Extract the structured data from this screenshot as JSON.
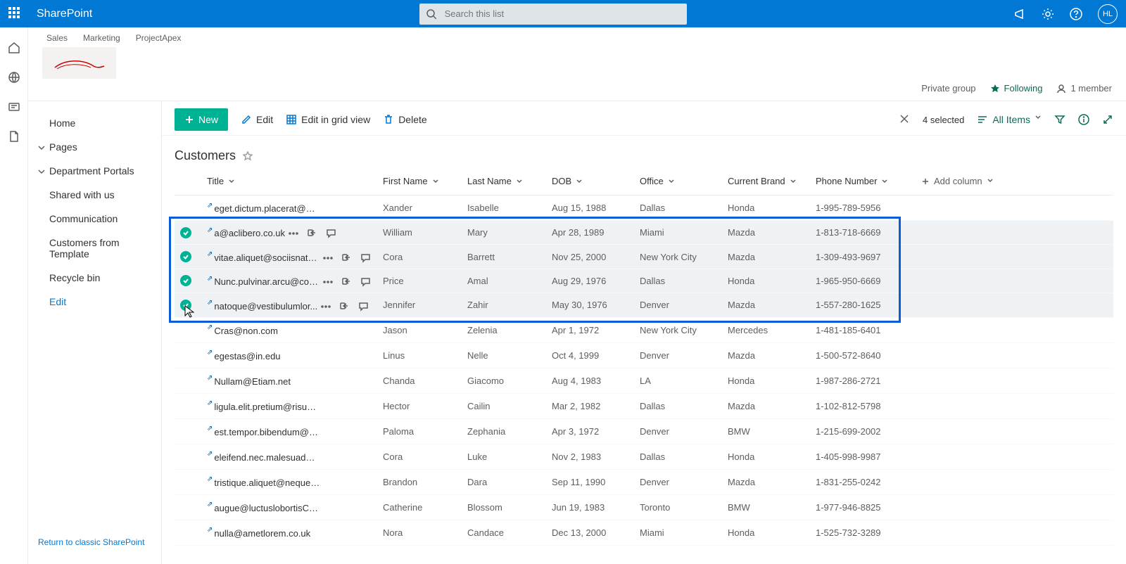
{
  "header": {
    "brand": "SharePoint",
    "search_placeholder": "Search this list",
    "avatar": "HL"
  },
  "site": {
    "tabs": [
      "Sales",
      "Marketing",
      "ProjectApex"
    ],
    "privacy": "Private group",
    "following": "Following",
    "members": "1 member"
  },
  "nav": {
    "items": [
      {
        "label": "Home",
        "chev": false
      },
      {
        "label": "Pages",
        "chev": true
      },
      {
        "label": "Department Portals",
        "chev": true
      },
      {
        "label": "Shared with us",
        "chev": false
      },
      {
        "label": "Communication",
        "chev": false
      },
      {
        "label": "Customers from Template",
        "chev": false
      },
      {
        "label": "Recycle bin",
        "chev": false
      },
      {
        "label": "Edit",
        "chev": false,
        "sel": true
      }
    ],
    "foot": "Return to classic SharePoint"
  },
  "cmd": {
    "new": "New",
    "edit": "Edit",
    "grid": "Edit in grid view",
    "del": "Delete",
    "selected": "4 selected",
    "allitems": "All Items"
  },
  "list": {
    "title": "Customers",
    "columns": [
      "Title",
      "First Name",
      "Last Name",
      "DOB",
      "Office",
      "Current Brand",
      "Phone Number"
    ],
    "addcol": "Add column",
    "rows": [
      {
        "sel": false,
        "title": "eget.dictum.placerat@mattis.ca",
        "first": "Xander",
        "last": "Isabelle",
        "dob": "Aug 15, 1988",
        "office": "Dallas",
        "brand": "Honda",
        "phone": "1-995-789-5956"
      },
      {
        "sel": true,
        "title": "a@aclibero.co.uk",
        "first": "William",
        "last": "Mary",
        "dob": "Apr 28, 1989",
        "office": "Miami",
        "brand": "Mazda",
        "phone": "1-813-718-6669"
      },
      {
        "sel": true,
        "title": "vitae.aliquet@sociisnato...",
        "first": "Cora",
        "last": "Barrett",
        "dob": "Nov 25, 2000",
        "office": "New York City",
        "brand": "Mazda",
        "phone": "1-309-493-9697"
      },
      {
        "sel": true,
        "title": "Nunc.pulvinar.arcu@con...",
        "first": "Price",
        "last": "Amal",
        "dob": "Aug 29, 1976",
        "office": "Dallas",
        "brand": "Honda",
        "phone": "1-965-950-6669"
      },
      {
        "sel": true,
        "title": "natoque@vestibulumlor...",
        "first": "Jennifer",
        "last": "Zahir",
        "dob": "May 30, 1976",
        "office": "Denver",
        "brand": "Mazda",
        "phone": "1-557-280-1625"
      },
      {
        "sel": false,
        "title": "Cras@non.com",
        "first": "Jason",
        "last": "Zelenia",
        "dob": "Apr 1, 1972",
        "office": "New York City",
        "brand": "Mercedes",
        "phone": "1-481-185-6401"
      },
      {
        "sel": false,
        "title": "egestas@in.edu",
        "first": "Linus",
        "last": "Nelle",
        "dob": "Oct 4, 1999",
        "office": "Denver",
        "brand": "Mazda",
        "phone": "1-500-572-8640"
      },
      {
        "sel": false,
        "title": "Nullam@Etiam.net",
        "first": "Chanda",
        "last": "Giacomo",
        "dob": "Aug 4, 1983",
        "office": "LA",
        "brand": "Honda",
        "phone": "1-987-286-2721"
      },
      {
        "sel": false,
        "title": "ligula.elit.pretium@risus.ca",
        "first": "Hector",
        "last": "Cailin",
        "dob": "Mar 2, 1982",
        "office": "Dallas",
        "brand": "Mazda",
        "phone": "1-102-812-5798"
      },
      {
        "sel": false,
        "title": "est.tempor.bibendum@neccursusa.com",
        "first": "Paloma",
        "last": "Zephania",
        "dob": "Apr 3, 1972",
        "office": "Denver",
        "brand": "BMW",
        "phone": "1-215-699-2002"
      },
      {
        "sel": false,
        "title": "eleifend.nec.malesuada@atrisus.ca",
        "first": "Cora",
        "last": "Luke",
        "dob": "Nov 2, 1983",
        "office": "Dallas",
        "brand": "Honda",
        "phone": "1-405-998-9987"
      },
      {
        "sel": false,
        "title": "tristique.aliquet@neque.co.uk",
        "first": "Brandon",
        "last": "Dara",
        "dob": "Sep 11, 1990",
        "office": "Denver",
        "brand": "Mazda",
        "phone": "1-831-255-0242"
      },
      {
        "sel": false,
        "title": "augue@luctuslobortisClass.co.uk",
        "first": "Catherine",
        "last": "Blossom",
        "dob": "Jun 19, 1983",
        "office": "Toronto",
        "brand": "BMW",
        "phone": "1-977-946-8825"
      },
      {
        "sel": false,
        "title": "nulla@ametlorem.co.uk",
        "first": "Nora",
        "last": "Candace",
        "dob": "Dec 13, 2000",
        "office": "Miami",
        "brand": "Honda",
        "phone": "1-525-732-3289"
      }
    ]
  }
}
